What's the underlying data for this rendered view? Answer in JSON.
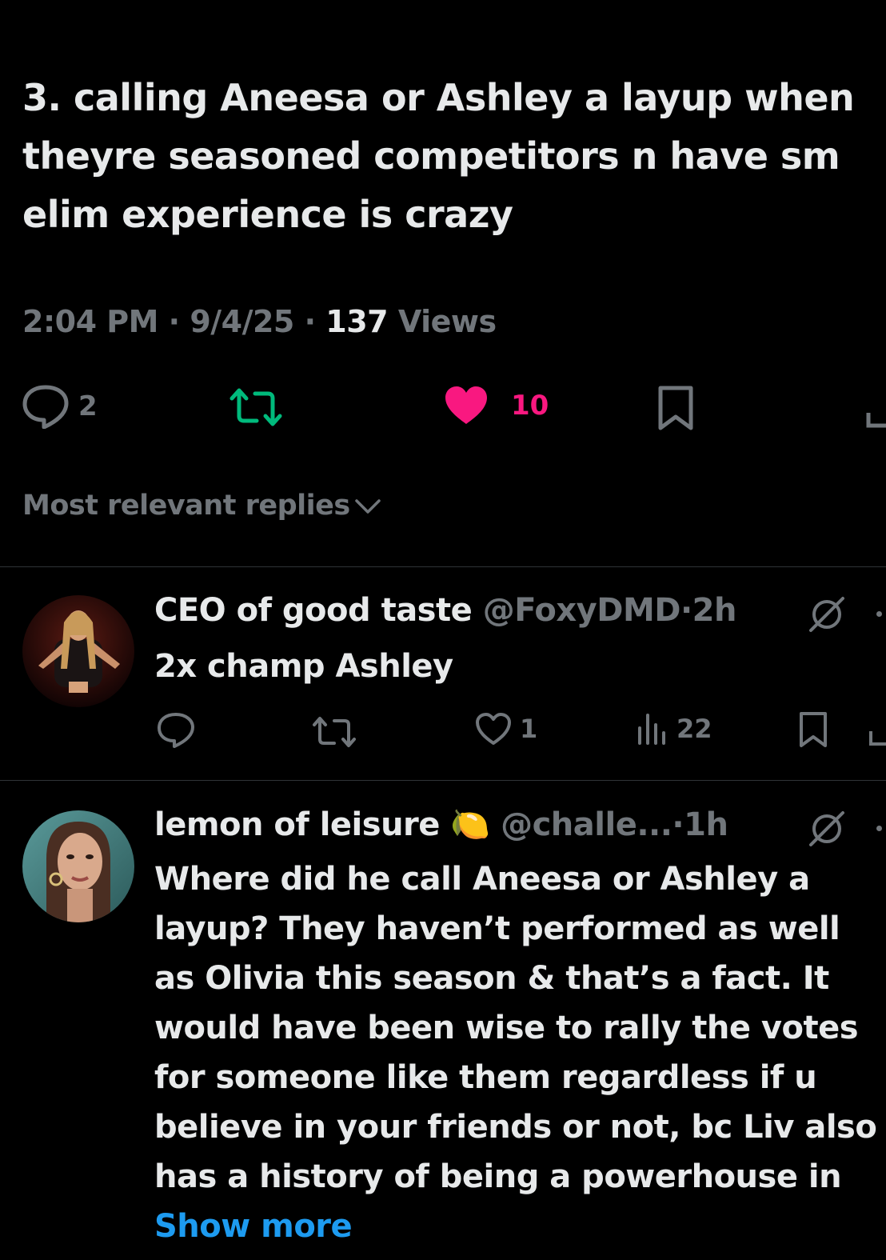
{
  "tweet": {
    "text": "3. calling Aneesa or Ashley a layup when theyre seasoned competitors n have sm elim experience is crazy",
    "time": "2:04 PM",
    "dot": "·",
    "date": "9/4/25",
    "views_count": "137",
    "views_label": "Views",
    "replies": "2",
    "likes": "10",
    "colors": {
      "like": "#f91880",
      "retweet": "#00ba7c",
      "muted": "#71767b"
    }
  },
  "sort": {
    "label": "Most relevant replies"
  },
  "replies": [
    {
      "name": "CEO of good taste",
      "handle": "@FoxyDMD",
      "sep": "·",
      "time": "2h",
      "text": "2x champ Ashley",
      "likes": "1",
      "views": "22"
    },
    {
      "name": "lemon of leisure",
      "emoji": "🍋",
      "handle": "@challe...",
      "sep": "·",
      "time": "1h",
      "text": "Where did he call Aneesa or Ashley a layup? They haven’t performed as well as Olivia this season & that’s a fact. It would have been wise to rally the votes for someone like them regardless if u believe in your friends or not, bc Liv also has a history of being a powerhouse in",
      "show_more": "Show more"
    }
  ]
}
